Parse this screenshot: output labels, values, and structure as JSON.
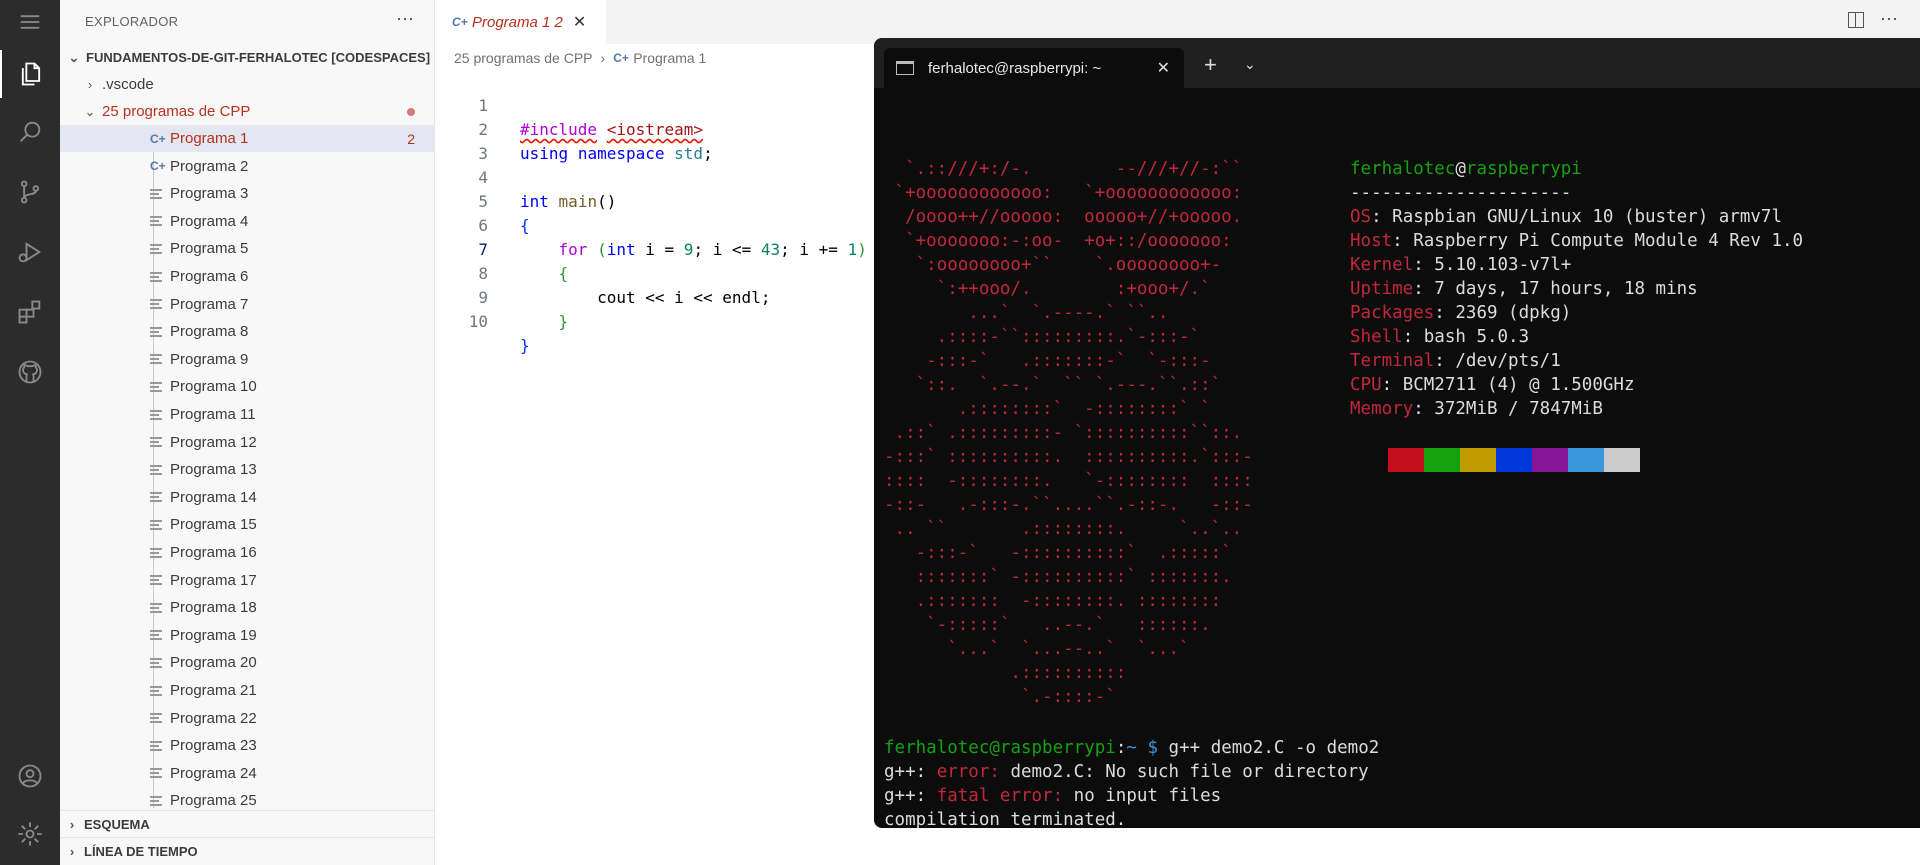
{
  "sidebar": {
    "title": "EXPLORADOR",
    "more": "···",
    "root": "FUNDAMENTOS-DE-GIT-FERHALOTEC [CODESPACES]",
    "vscode": ".vscode",
    "folder": "25 programas de CPP",
    "items": [
      "Programa 1",
      "Programa 2",
      "Programa 3",
      "Programa 4",
      "Programa 5",
      "Programa 6",
      "Programa 7",
      "Programa 8",
      "Programa 9",
      "Programa 10",
      "Programa 11",
      "Programa 12",
      "Programa 13",
      "Programa 14",
      "Programa 15",
      "Programa 16",
      "Programa 17",
      "Programa 18",
      "Programa 19",
      "Programa 20",
      "Programa 21",
      "Programa 22",
      "Programa 23",
      "Programa 24",
      "Programa 25"
    ],
    "error_count": "2",
    "outline": "ESQUEMA",
    "timeline": "LÍNEA DE TIEMPO"
  },
  "editor": {
    "tab_label": "Programa 1 2",
    "breadcrumb": [
      "25 programas de CPP",
      "Programa 1"
    ],
    "line_numbers": [
      "1",
      "2",
      "3",
      "4",
      "5",
      "6",
      "7",
      "8",
      "9",
      "10"
    ]
  },
  "terminal": {
    "tab_title": "ferhalotec@raspberrypi: ~",
    "user": "ferhalotec",
    "host": "raspberrypi",
    "separator": "---------------------",
    "info": [
      {
        "key": "OS",
        "value": "Raspbian GNU/Linux 10 (buster) armv7l"
      },
      {
        "key": "Host",
        "value": "Raspberry Pi Compute Module 4 Rev 1.0"
      },
      {
        "key": "Kernel",
        "value": "5.10.103-v7l+"
      },
      {
        "key": "Uptime",
        "value": "7 days, 17 hours, 18 mins"
      },
      {
        "key": "Packages",
        "value": "2369 (dpkg)"
      },
      {
        "key": "Shell",
        "value": "bash 5.0.3"
      },
      {
        "key": "Terminal",
        "value": "/dev/pts/1"
      },
      {
        "key": "CPU",
        "value": "BCM2711 (4) @ 1.500GHz"
      },
      {
        "key": "Memory",
        "value": "372MiB / 7847MiB"
      }
    ],
    "swatch_colors": [
      "#c50f1f",
      "#13a10e",
      "#c19c00",
      "#0037da",
      "#881798",
      "#3a96dd",
      "#cccccc"
    ],
    "command": "g++ demo2.C -o demo2",
    "err_line1_prefix": "g++: ",
    "err_line1_tag": "error:",
    "err_line1_text": " demo2.C: No such file or directory",
    "err_line2_prefix": "g++: ",
    "err_line2_tag": "fatal error:",
    "err_line2_text": " no input files",
    "err_line3": "compilation terminated."
  }
}
